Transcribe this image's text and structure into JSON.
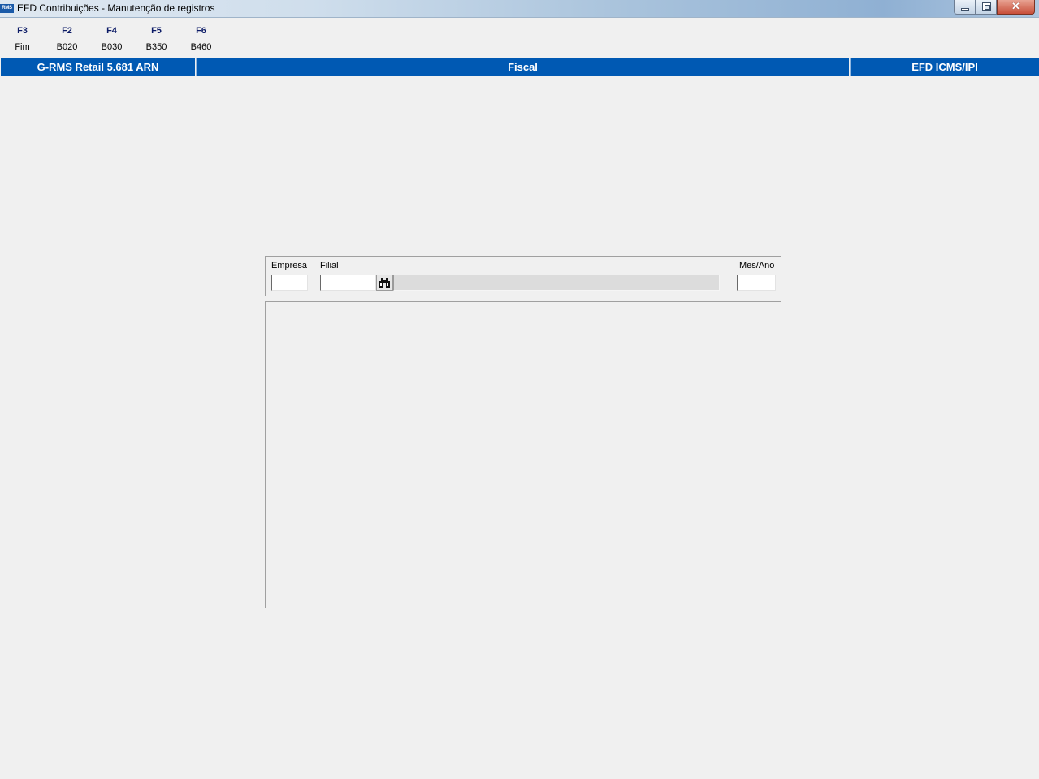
{
  "window": {
    "icon_text": "RMS",
    "title": "EFD Contribuições - Manutenção de registros"
  },
  "toolbar": {
    "keys": [
      {
        "key": "F3",
        "label": "Fim"
      },
      {
        "key": "F2",
        "label": "B020"
      },
      {
        "key": "F4",
        "label": "B030"
      },
      {
        "key": "F5",
        "label": "B350"
      },
      {
        "key": "F6",
        "label": "B460"
      }
    ]
  },
  "header": {
    "system": "G-RMS Retail 5.681 ARN",
    "module": "Fiscal",
    "submodule": "EFD ICMS/IPI"
  },
  "filters": {
    "empresa": {
      "label": "Empresa",
      "value": ""
    },
    "filial": {
      "label": "Filial",
      "value": "",
      "description": ""
    },
    "mes_ano": {
      "label": "Mes/Ano",
      "value": ""
    }
  },
  "colors": {
    "header_bg": "#0059b3",
    "window_bg": "#f0f0f0",
    "fkey_color": "#0b1a66"
  }
}
